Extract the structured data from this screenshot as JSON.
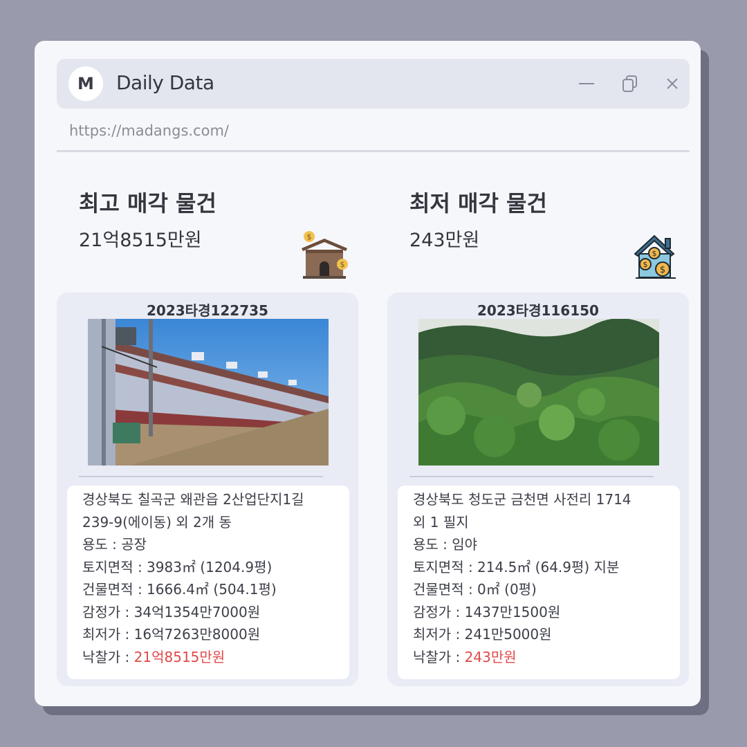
{
  "window": {
    "logo_letter": "M",
    "title": "Daily Data",
    "url": "https://madangs.com/",
    "controls": [
      "minimize-icon",
      "copy-icon",
      "close-icon"
    ]
  },
  "highest": {
    "heading": "최고 매각 물건",
    "price": "21억8515만원",
    "icon": "warehouse-money-icon",
    "case_no": "2023타경122735",
    "photo": "factory-building-photo",
    "address_line1": "경상북도 칠곡군 왜관읍 2산업단지1길",
    "address_line2": "239-9(에이동) 외 2개 동",
    "usage": "용도 : 공장",
    "land_area": "토지면적 : 3983㎡ (1204.9평)",
    "building_area": "건물면적 : 1666.4㎡ (504.1평)",
    "appraisal": "감정가 : 34억1354만7000원",
    "minimum": "최저가 : 16억7263만8000원",
    "winning_label": "낙찰가 : ",
    "winning_value": "21억8515만원"
  },
  "lowest": {
    "heading": "최저 매각 물건",
    "price": "243만원",
    "icon": "house-money-icon",
    "case_no": "2023타경116150",
    "photo": "forest-land-photo",
    "address_line1": "경상북도 청도군 금천면 사전리 1714",
    "address_line2": "외 1 필지",
    "usage": "용도 : 임야",
    "land_area": "토지면적 : 214.5㎡ (64.9평) 지분",
    "building_area": "건물면적 : 0㎡ (0평)",
    "appraisal": "감정가 : 1437만1500원",
    "minimum": "최저가 : 241만5000원",
    "winning_label": "낙찰가 : ",
    "winning_value": "243만원"
  },
  "colors": {
    "background": "#999aab",
    "window": "#f6f7fb",
    "titlebar": "#e4e6ef",
    "card": "#e9ebf5",
    "accent_red": "#e24848"
  }
}
